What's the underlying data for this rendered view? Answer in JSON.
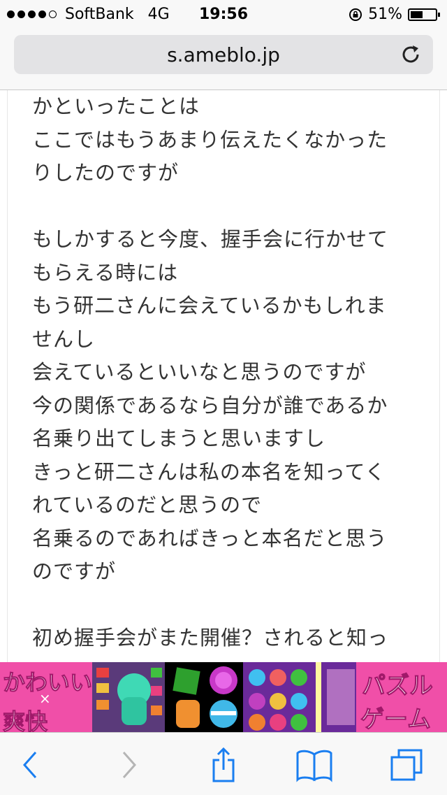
{
  "status_bar": {
    "carrier": "SoftBank",
    "network": "4G",
    "time": "19:56",
    "battery_percent": "51%",
    "battery_level": 0.51,
    "signal_bars_filled": 4,
    "signal_bars_total": 5
  },
  "url_bar": {
    "url": "s.ameblo.jp",
    "reload_icon": "reload-icon"
  },
  "article": {
    "lines": [
      "かといったことは",
      "ここではもうあまり伝えたくなかった",
      "りしたのですが",
      "",
      "もしかすると今度、握手会に行かせて",
      "もらえる時には",
      "もう研二さんに会えているかもしれま",
      "せんし",
      "会えているといいなと思うのですが",
      "今の関係であるなら自分が誰であるか",
      "名乗り出てしまうと思いますし",
      "きっと研二さんは私の本名を知ってく",
      "れているのだと思うので",
      "名乗るのであればきっと本名だと思う",
      "のですが",
      "",
      "初め握手会がまた開催？されると知っ"
    ]
  },
  "ad": {
    "left_line1": "かわいい",
    "left_x": "×",
    "left_line2": "爽快",
    "right_line1": "パズル",
    "right_line2": "ゲーム",
    "colors": {
      "pink": "#f04fa8"
    }
  },
  "toolbar": {
    "icons": [
      "back-icon",
      "forward-icon",
      "share-icon",
      "bookmarks-icon",
      "tabs-icon"
    ],
    "accent": "#1a7ef0"
  }
}
